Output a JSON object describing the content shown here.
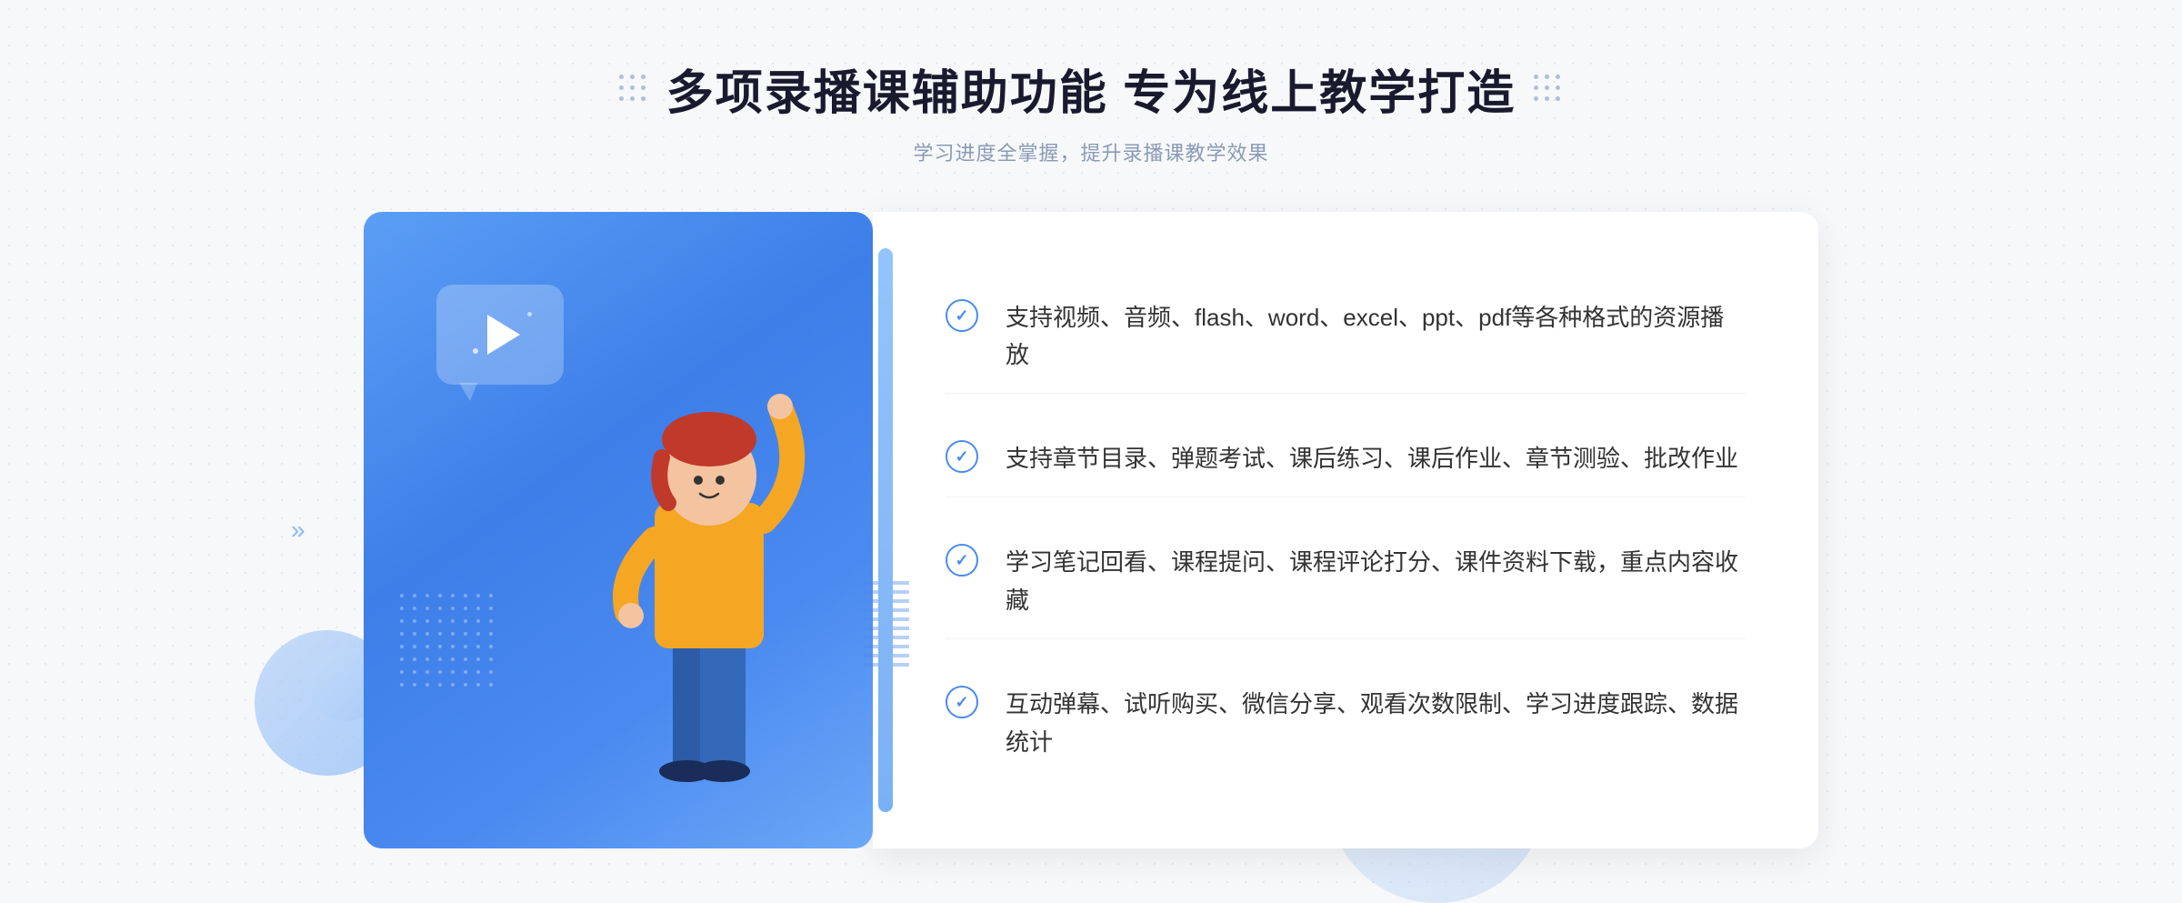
{
  "header": {
    "main_title": "多项录播课辅助功能 专为线上教学打造",
    "sub_title": "学习进度全掌握，提升录播课教学效果"
  },
  "decorative": {
    "left_dots_label": "decorative dots left",
    "right_dots_label": "decorative dots right"
  },
  "features": [
    {
      "id": 1,
      "text": "支持视频、音频、flash、word、excel、ppt、pdf等各种格式的资源播放"
    },
    {
      "id": 2,
      "text": "支持章节目录、弹题考试、课后练习、课后作业、章节测验、批改作业"
    },
    {
      "id": 3,
      "text": "学习笔记回看、课程提问、课程评论打分、课件资料下载，重点内容收藏"
    },
    {
      "id": 4,
      "text": "互动弹幕、试听购买、微信分享、观看次数限制、学习进度跟踪、数据统计"
    }
  ],
  "colors": {
    "primary_blue": "#4a8af0",
    "light_blue": "#93c4fb",
    "dark_text": "#1a1a2e",
    "sub_text": "#8a9ab5",
    "feature_text": "#333333"
  }
}
